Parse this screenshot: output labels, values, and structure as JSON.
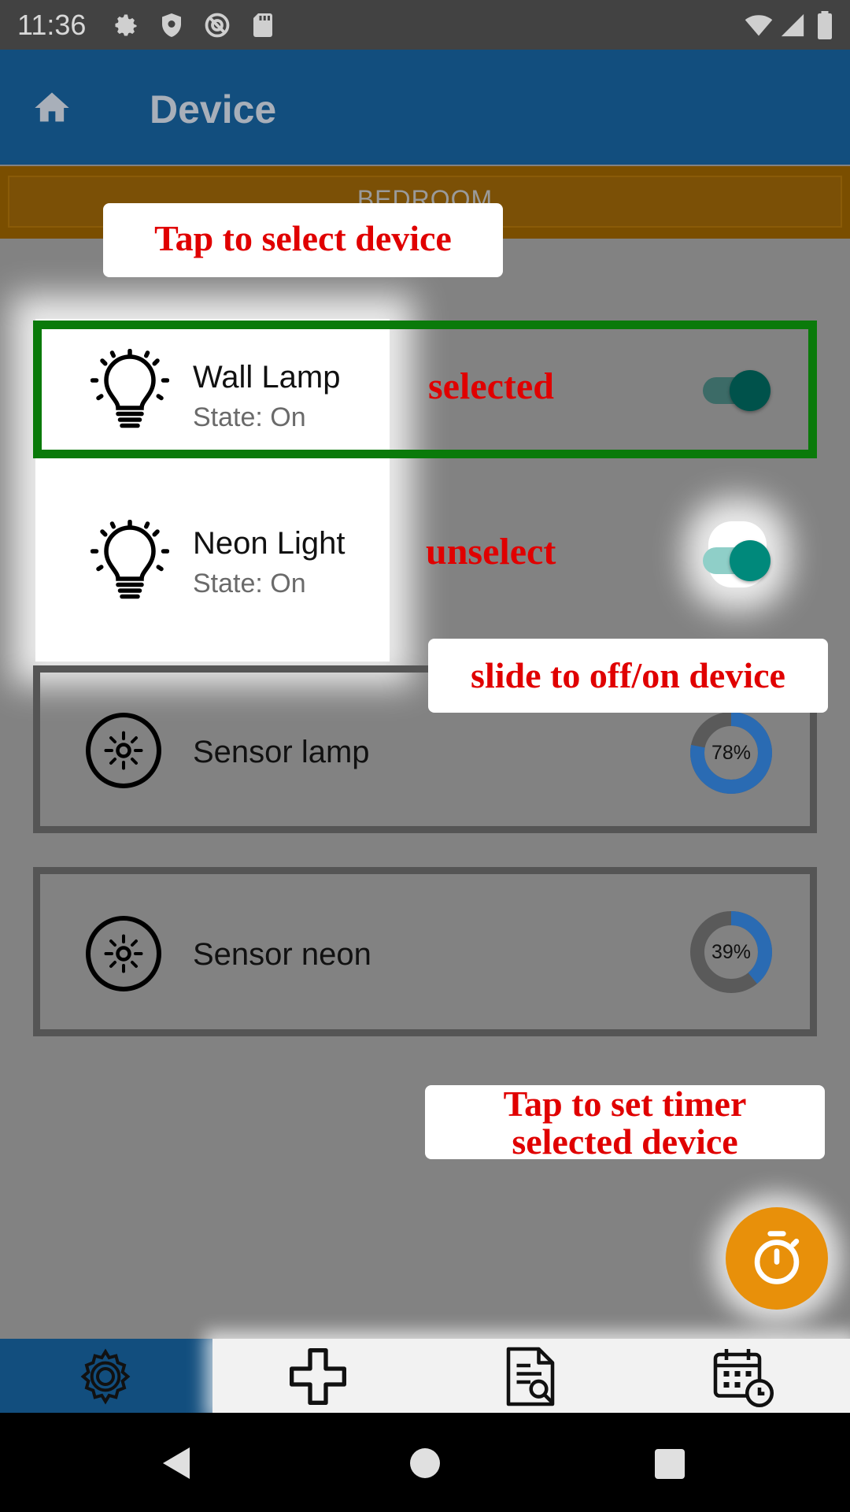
{
  "status_bar": {
    "time": "11:36"
  },
  "app_bar": {
    "title": "Device",
    "home_icon": "home-icon"
  },
  "room": {
    "label": "BEDROOM"
  },
  "devices": [
    {
      "name": "Wall Lamp",
      "state": "State: On",
      "icon": "light-bulb-icon",
      "toggle_on": true,
      "selected": true
    },
    {
      "name": "Neon Light",
      "state": "State: On",
      "icon": "light-bulb-icon",
      "toggle_on": true,
      "selected": false
    }
  ],
  "sensors": [
    {
      "name": "Sensor lamp",
      "percent_label": "78%",
      "percent": 78
    },
    {
      "name": "Sensor neon",
      "percent_label": "39%",
      "percent": 39
    }
  ],
  "annotations": {
    "tap_select": "Tap to select device",
    "selected": "selected",
    "unselect": "unselect",
    "slide": "slide to off/on device",
    "timer_line1": "Tap to set timer",
    "timer_line2": "selected device"
  },
  "bottom_nav": [
    {
      "name": "settings",
      "icon": "gear-icon",
      "active": true
    },
    {
      "name": "add",
      "icon": "plus-icon",
      "active": false
    },
    {
      "name": "report",
      "icon": "document-search-icon",
      "active": false
    },
    {
      "name": "schedule",
      "icon": "calendar-clock-icon",
      "active": false
    }
  ],
  "colors": {
    "app_bar": "#124e7e",
    "room_banner": "#7a4e00",
    "selected_border": "#0a7a0a",
    "toggle_on": "#00897b",
    "fab": "#e8900a",
    "annotation": "#e00000"
  }
}
